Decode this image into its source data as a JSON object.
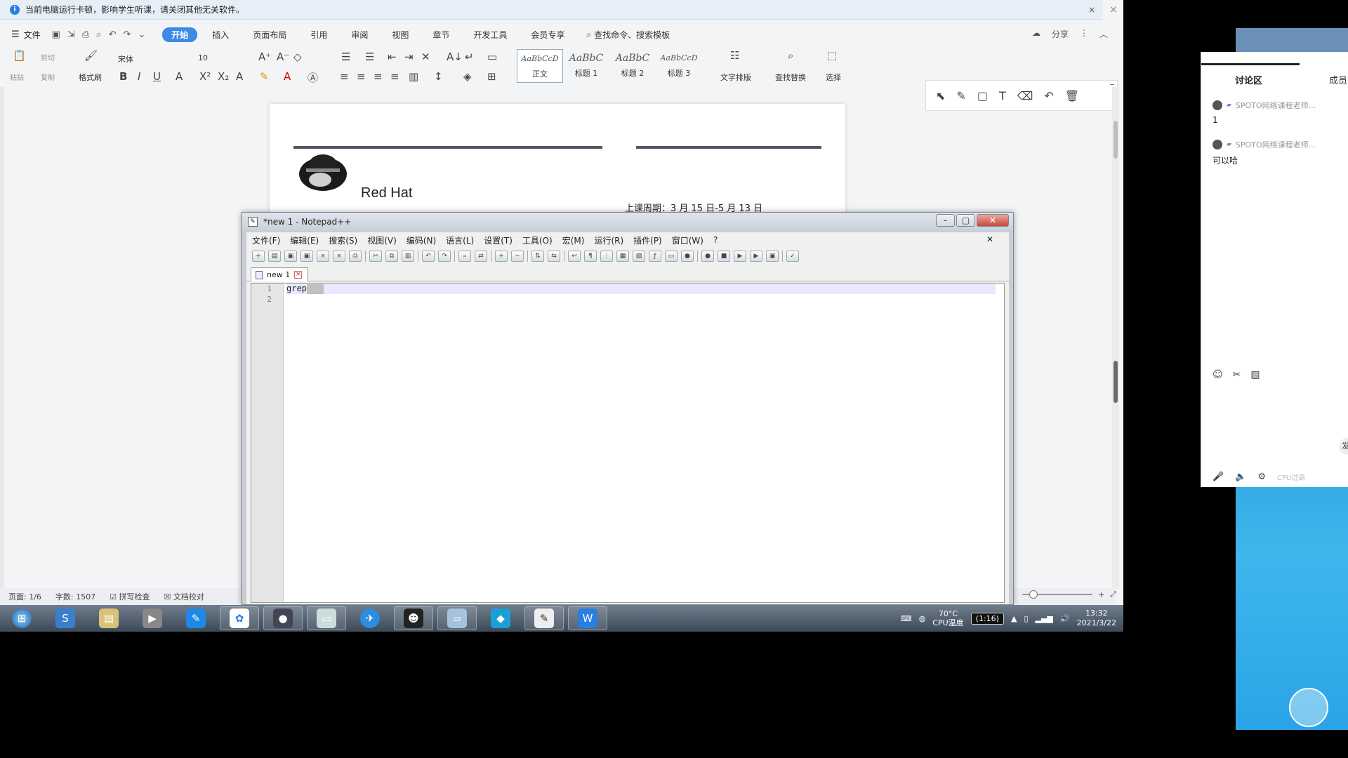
{
  "wps": {
    "notice": "当前电脑运行卡顿，影响学生听课，请关闭其他无关软件。",
    "file_menu": "文件",
    "tabs": [
      "开始",
      "插入",
      "页面布局",
      "引用",
      "审阅",
      "视图",
      "章节",
      "开发工具",
      "会员专享"
    ],
    "search": "查找命令、搜索模板",
    "share": "分享",
    "ribbon": {
      "paste": "粘贴",
      "cut": "剪切",
      "copy": "复制",
      "format_painter": "格式刷",
      "font_name": "宋体",
      "font_size": "10",
      "text_layout": "文字排版",
      "find_replace": "查找替换",
      "select": "选择"
    },
    "styles": [
      {
        "preview": "AaBbCcD",
        "label": "正文"
      },
      {
        "preview": "AaBbC",
        "label": "标题 1"
      },
      {
        "preview": "AaBbC",
        "label": "标题 2"
      },
      {
        "preview": "AaBbCcD",
        "label": "标题 3"
      }
    ],
    "document": {
      "company": "Red Hat",
      "dates": "上课周期：3 月 15 日-5 月 13 日"
    },
    "status": {
      "page": "页面: 1/6",
      "words": "字数: 1507",
      "spell": "拼写检查",
      "proof": "文档校对"
    }
  },
  "notepad": {
    "title": "*new 1 - Notepad++",
    "menu": [
      "文件(F)",
      "编辑(E)",
      "搜索(S)",
      "视图(V)",
      "编码(N)",
      "语言(L)",
      "设置(T)",
      "工具(O)",
      "宏(M)",
      "运行(R)",
      "插件(P)",
      "窗口(W)",
      "?"
    ],
    "tab": "new 1",
    "lines": [
      "1",
      "2"
    ],
    "code": [
      "grep",
      ""
    ]
  },
  "taskbar": {
    "temp": "70°C",
    "temp_label": "CPU温度",
    "timer": "(1:16)",
    "time": "13:32",
    "date": "2021/3/22"
  },
  "discussion": {
    "title": "讨论区",
    "members": "成员",
    "messages": [
      {
        "name": "SPOTO网络课程老师...",
        "body": "1"
      },
      {
        "name": "SPOTO网络课程老师...",
        "body": "可以哈"
      }
    ],
    "cpu_text": "CPU过高"
  }
}
